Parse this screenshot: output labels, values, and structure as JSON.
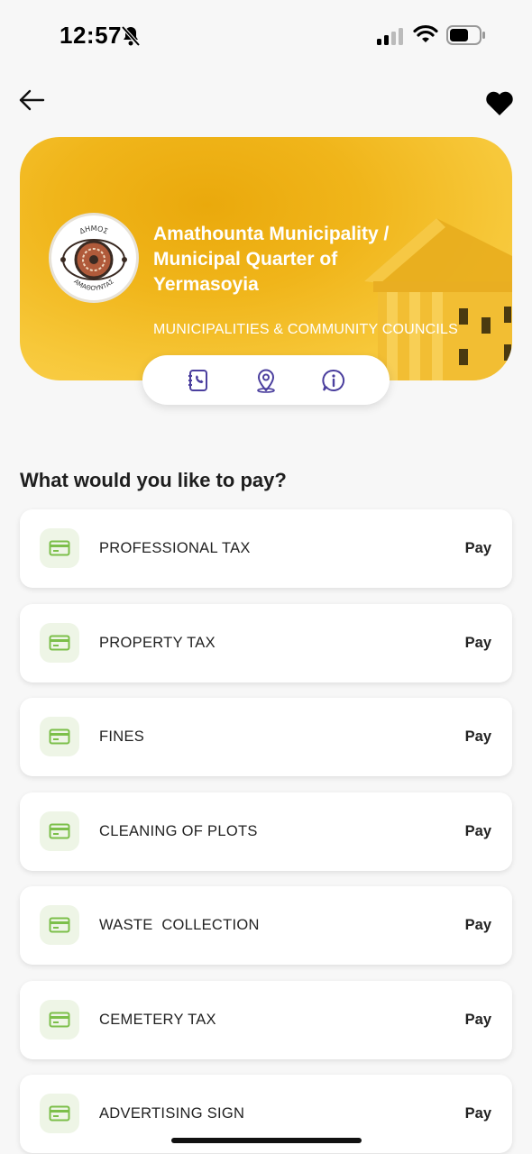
{
  "status_bar": {
    "time": "12:57"
  },
  "header": {
    "title": "Amathounta Municipality /\nMunicipal Quarter of\n Yermasoyia",
    "category": "MUNICIPALITIES & COMMUNITY COUNCILS",
    "logo_text_top": "ΔΗΜΟΣ",
    "logo_text_bottom": "ΑΜΑΘΟΥΝΤΑΣ"
  },
  "actions": [
    {
      "icon": "contacts-icon"
    },
    {
      "icon": "location-pin-icon"
    },
    {
      "icon": "info-icon"
    }
  ],
  "section_title": "What would you like to pay?",
  "pay_items": [
    {
      "label": "PROFESSIONAL TAX",
      "action": "Pay"
    },
    {
      "label": "PROPERTY TAX",
      "action": "Pay"
    },
    {
      "label": "FINES",
      "action": "Pay"
    },
    {
      "label": "CLEANING OF PLOTS",
      "action": "Pay"
    },
    {
      "label": "WASTE  COLLECTION",
      "action": "Pay"
    },
    {
      "label": "CEMETERY TAX",
      "action": "Pay"
    },
    {
      "label": "ADVERTISING SIGN",
      "action": "Pay"
    }
  ],
  "colors": {
    "accent_gold": "#f0b51a",
    "icon_purple": "#4b3f9e",
    "card_icon_green": "#7cbf4a"
  }
}
